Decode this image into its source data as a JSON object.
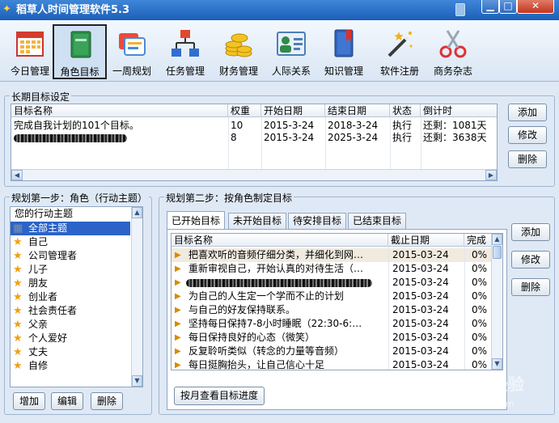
{
  "app": {
    "title": "稻草人时间管理软件5.3"
  },
  "toolbar": [
    {
      "label": "今日管理",
      "icon": "calendar-icon"
    },
    {
      "label": "角色目标",
      "icon": "book-icon"
    },
    {
      "label": "一周规划",
      "icon": "cards-icon"
    },
    {
      "label": "任务管理",
      "icon": "org-chart-icon"
    },
    {
      "label": "财务管理",
      "icon": "coins-icon"
    },
    {
      "label": "人际关系",
      "icon": "contact-card-icon"
    },
    {
      "label": "知识管理",
      "icon": "bookmark-book-icon"
    },
    {
      "label": "软件注册",
      "icon": "magic-wand-icon"
    },
    {
      "label": "商务杂志",
      "icon": "scissors-icon"
    }
  ],
  "long_term": {
    "title": "长期目标设定",
    "columns": [
      "目标名称",
      "权重",
      "开始日期",
      "结束日期",
      "状态",
      "倒计时"
    ],
    "rows": [
      {
        "name": "完成自我计划的101个目标。",
        "weight": "10",
        "start": "2015-3-24",
        "end": "2018-3-24",
        "status": "执行",
        "countdown": "还剩：1081天"
      },
      {
        "name": "",
        "weight": "8",
        "start": "2015-3-24",
        "end": "2025-3-24",
        "status": "执行",
        "countdown": "还剩：3638天"
      }
    ],
    "buttons": {
      "add": "添加",
      "edit": "修改",
      "delete": "删除"
    }
  },
  "step1": {
    "title": "规划第一步：角色（行动主题）",
    "header": "您的行动主题",
    "items": [
      "全部主题",
      "自己",
      "公司管理者",
      "儿子",
      "朋友",
      "创业者",
      "社会责任者",
      "父亲",
      "个人爱好",
      "丈夫",
      "自修"
    ],
    "buttons": {
      "add": "增加",
      "edit": "编辑",
      "delete": "删除"
    }
  },
  "step2": {
    "title": "规划第二步：按角色制定目标",
    "tabs": [
      "已开始目标",
      "未开始目标",
      "待安排目标",
      "已结束目标"
    ],
    "columns": [
      "目标名称",
      "截止日期",
      "完成"
    ],
    "rows": [
      {
        "name": "把喜欢听的音频仔细分类，并细化到网…",
        "deadline": "2015-03-24",
        "done": "0%"
      },
      {
        "name": "重新审视自己，开始认真的对待生活（…",
        "deadline": "2015-03-24",
        "done": "0%"
      },
      {
        "name": "",
        "deadline": "2015-03-24",
        "done": "0%"
      },
      {
        "name": "为自己的人生定一个学而不止的计划",
        "deadline": "2015-03-24",
        "done": "0%"
      },
      {
        "name": "与自己的好友保持联系。",
        "deadline": "2015-03-24",
        "done": "0%"
      },
      {
        "name": "坚持每日保持7-8小时睡眠（22:30-6:…",
        "deadline": "2015-03-24",
        "done": "0%"
      },
      {
        "name": "每日保持良好的心态（微笑）",
        "deadline": "2015-03-24",
        "done": "0%"
      },
      {
        "name": "反复聆听类似（转念的力量等音频）",
        "deadline": "2015-03-24",
        "done": "0%"
      },
      {
        "name": "每日挺胸抬头，让自己信心十足",
        "deadline": "2015-03-24",
        "done": "0%"
      }
    ],
    "monthly_button": "按月查看目标进度",
    "buttons": {
      "add": "添加",
      "edit": "修改",
      "delete": "删除"
    }
  },
  "watermark": {
    "brand": "Bai",
    "logo_text": "经验",
    "url": "jingyan.baidu.com"
  }
}
